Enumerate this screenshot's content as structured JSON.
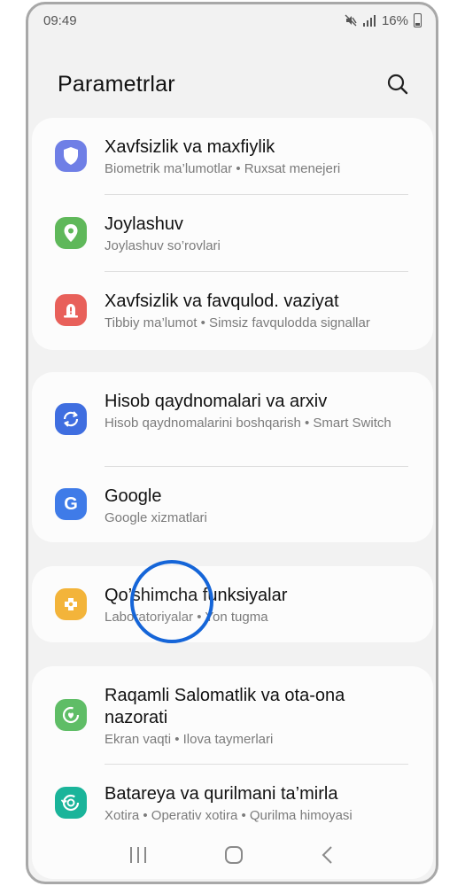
{
  "status": {
    "time": "09:49",
    "battery": "16%"
  },
  "header": {
    "title": "Parametrlar"
  },
  "groups": [
    {
      "items": [
        {
          "title": "Xavfsizlik va maxfiylik",
          "subtitle": "Biometrik ma’lumotlar  •  Ruxsat menejeri",
          "icon": "shield-icon",
          "color": "#6f7fe6"
        },
        {
          "title": "Joylashuv",
          "subtitle": "Joylashuv so’rovlari",
          "icon": "location-pin-icon",
          "color": "#5fb85a"
        },
        {
          "title": "Xavfsizlik va favqulod. vaziyat",
          "subtitle": "Tibbiy ma’lumot  •  Simsiz favqulodda signallar",
          "icon": "emergency-icon",
          "color": "#e8605a"
        }
      ]
    },
    {
      "items": [
        {
          "title": "Hisob qaydnomalari va arxiv",
          "subtitle": "Hisob qaydnomalarini boshqarish  •  Smart Switch",
          "icon": "sync-icon",
          "color": "#3f6ee0"
        },
        {
          "title": "Google",
          "subtitle": "Google xizmatlari",
          "icon": "google-icon",
          "color": "#3f7be8"
        }
      ]
    },
    {
      "items": [
        {
          "title": "Qo’shimcha funksiyalar",
          "subtitle": "Laboratoriyalar  •  Yon tugma",
          "icon": "puzzle-icon",
          "color": "#f3b43a"
        }
      ]
    },
    {
      "items": [
        {
          "title": "Raqamli Salomatlik va ota-ona nazorati",
          "subtitle": "Ekran vaqti  •  Ilova taymerlari",
          "icon": "wellbeing-icon",
          "color": "#5fbd66"
        },
        {
          "title": "Batareya va qurilmani ta’mirla",
          "subtitle": "Xotira  •  Operativ xotira  •  Qurilma himoyasi",
          "icon": "device-care-icon",
          "color": "#1ab49a"
        }
      ]
    }
  ]
}
